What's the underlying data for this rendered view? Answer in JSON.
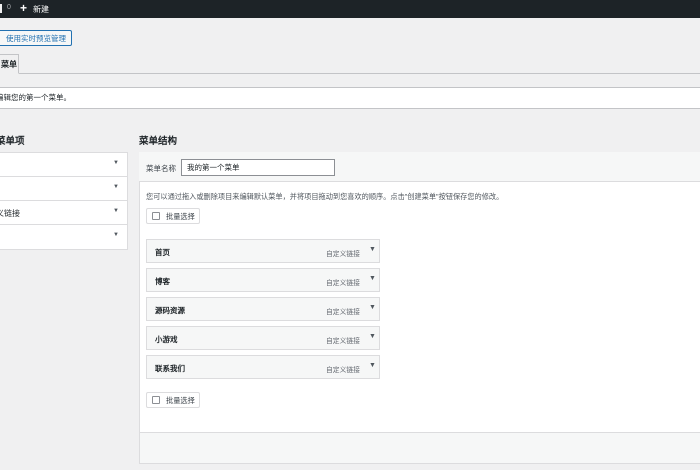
{
  "admin_bar": {
    "comment_count": "0",
    "new_label": "新建"
  },
  "live_preview_button": "使用实时预览管理",
  "tabs": {
    "active": "菜单"
  },
  "notice": "编辑您的第一个菜单。",
  "left_panel": {
    "title": "菜单项",
    "sections": [
      {
        "label": ""
      },
      {
        "label": ""
      },
      {
        "label": "义链接"
      },
      {
        "label": ""
      }
    ]
  },
  "right_panel": {
    "title": "菜单结构",
    "menu_name_label": "菜单名称",
    "menu_name_value": "我的第一个菜单",
    "description": "您可以通过拖入或删除项目来编辑默认菜单，并将项目拖动到您喜欢的顺序。点击\"创建菜单\"按钮保存您的修改。",
    "bulk_select_label": "批量选择",
    "items": [
      {
        "title": "首页",
        "type": "自定义链接"
      },
      {
        "title": "博客",
        "type": "自定义链接"
      },
      {
        "title": "源码资源",
        "type": "自定义链接"
      },
      {
        "title": "小游戏",
        "type": "自定义链接"
      },
      {
        "title": "联系我们",
        "type": "自定义链接"
      }
    ]
  }
}
